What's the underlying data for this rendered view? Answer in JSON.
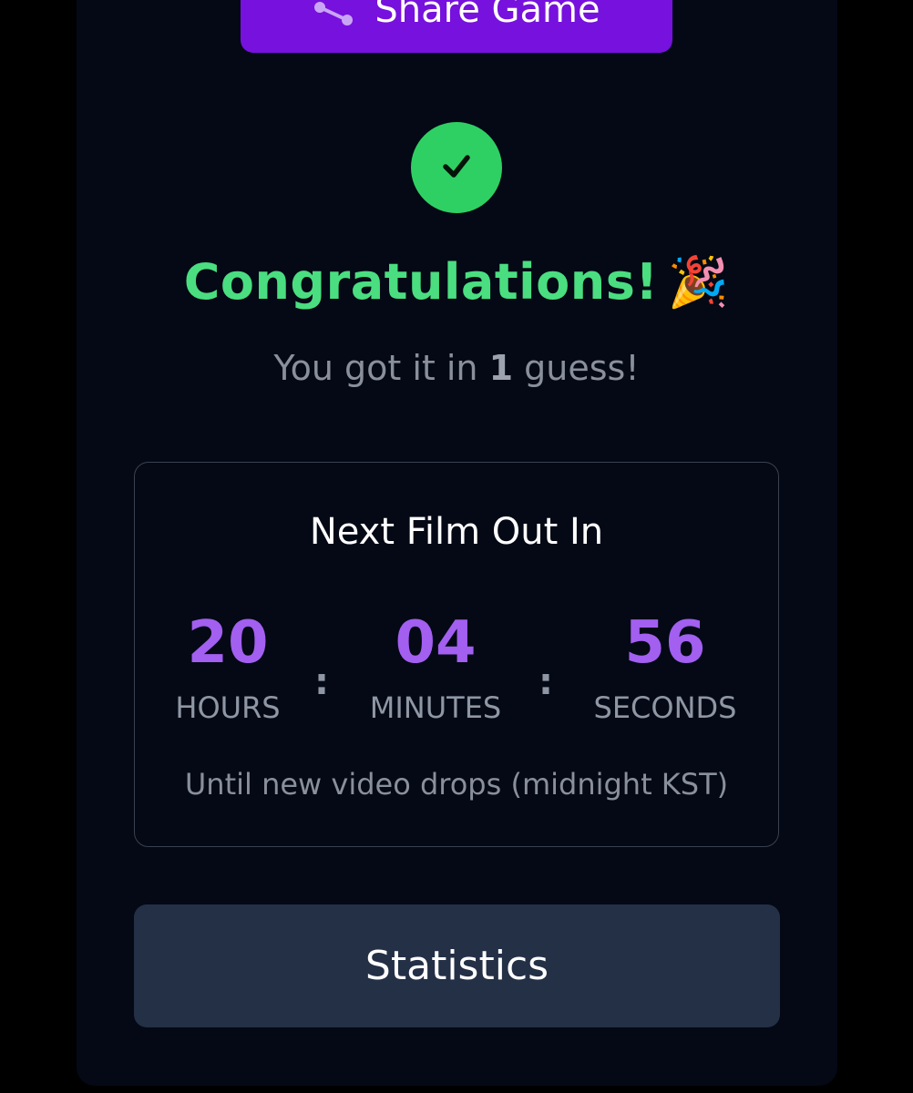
{
  "share": {
    "label": "Share Game",
    "icon": "share-icon",
    "color": "#7711dd"
  },
  "result": {
    "status_icon": "check-icon",
    "title": "Congratulations!",
    "title_emoji": "🎉",
    "guess_prefix": "You got it in",
    "guess_count": "1",
    "guess_suffix": "guess!"
  },
  "countdown": {
    "title": "Next Film Out In",
    "hours": "20",
    "hours_label": "HOURS",
    "minutes": "04",
    "minutes_label": "MINUTES",
    "seconds": "56",
    "seconds_label": "SECONDS",
    "separator": ":",
    "note": "Until new video drops (midnight KST)"
  },
  "statistics": {
    "label": "Statistics"
  },
  "colors": {
    "background": "#000000",
    "panel": "#040915",
    "accent_purple": "#a25ff0",
    "success_green": "#4ade80",
    "button_dark": "#233046"
  }
}
